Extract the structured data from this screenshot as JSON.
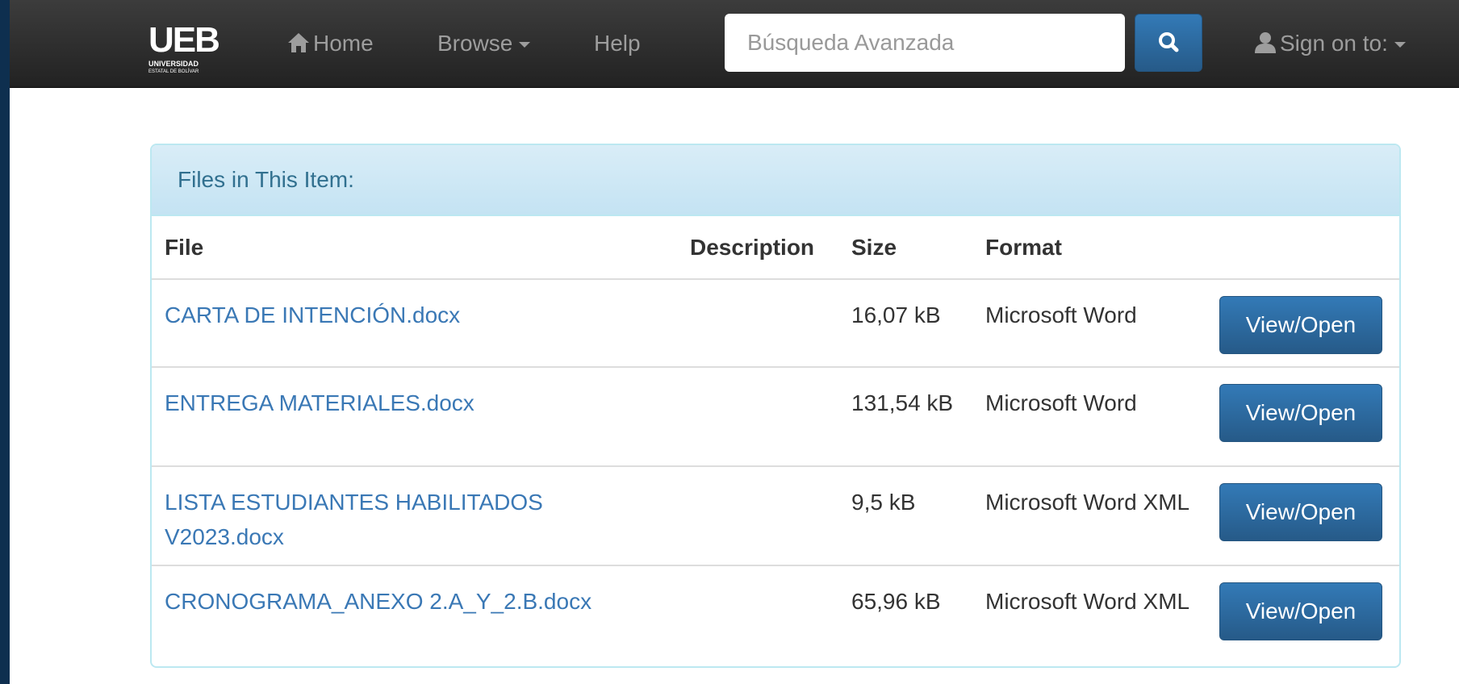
{
  "navbar": {
    "logo": {
      "main": "UEB",
      "line1": "UNIVERSIDAD",
      "line2": "ESTATAL DE BOLÍVAR"
    },
    "home_label": "Home",
    "browse_label": "Browse",
    "help_label": "Help",
    "search_placeholder": "Búsqueda Avanzada",
    "signon_label": "Sign on to:"
  },
  "panel": {
    "title": "Files in This Item:",
    "columns": {
      "file": "File",
      "description": "Description",
      "size": "Size",
      "format": "Format"
    },
    "button_label": "View/Open",
    "rows": [
      {
        "file": "CARTA DE INTENCIÓN.docx",
        "description": "",
        "size": "16,07 kB",
        "format": "Microsoft Word"
      },
      {
        "file": "ENTREGA MATERIALES.docx",
        "description": "",
        "size": "131,54 kB",
        "format": "Microsoft Word"
      },
      {
        "file": "LISTA ESTUDIANTES HABILITADOS V2023.docx",
        "description": "",
        "size": "9,5 kB",
        "format": "Microsoft Word XML"
      },
      {
        "file": "CRONOGRAMA_ANEXO 2.A_Y_2.B.docx",
        "description": "",
        "size": "65,96 kB",
        "format": "Microsoft Word XML"
      }
    ]
  },
  "colors": {
    "navbar": "#222222",
    "link": "#3a78b5",
    "button": "#337ab7",
    "panel_heading": "#d9edf7",
    "frame": "#0e2f4f"
  }
}
